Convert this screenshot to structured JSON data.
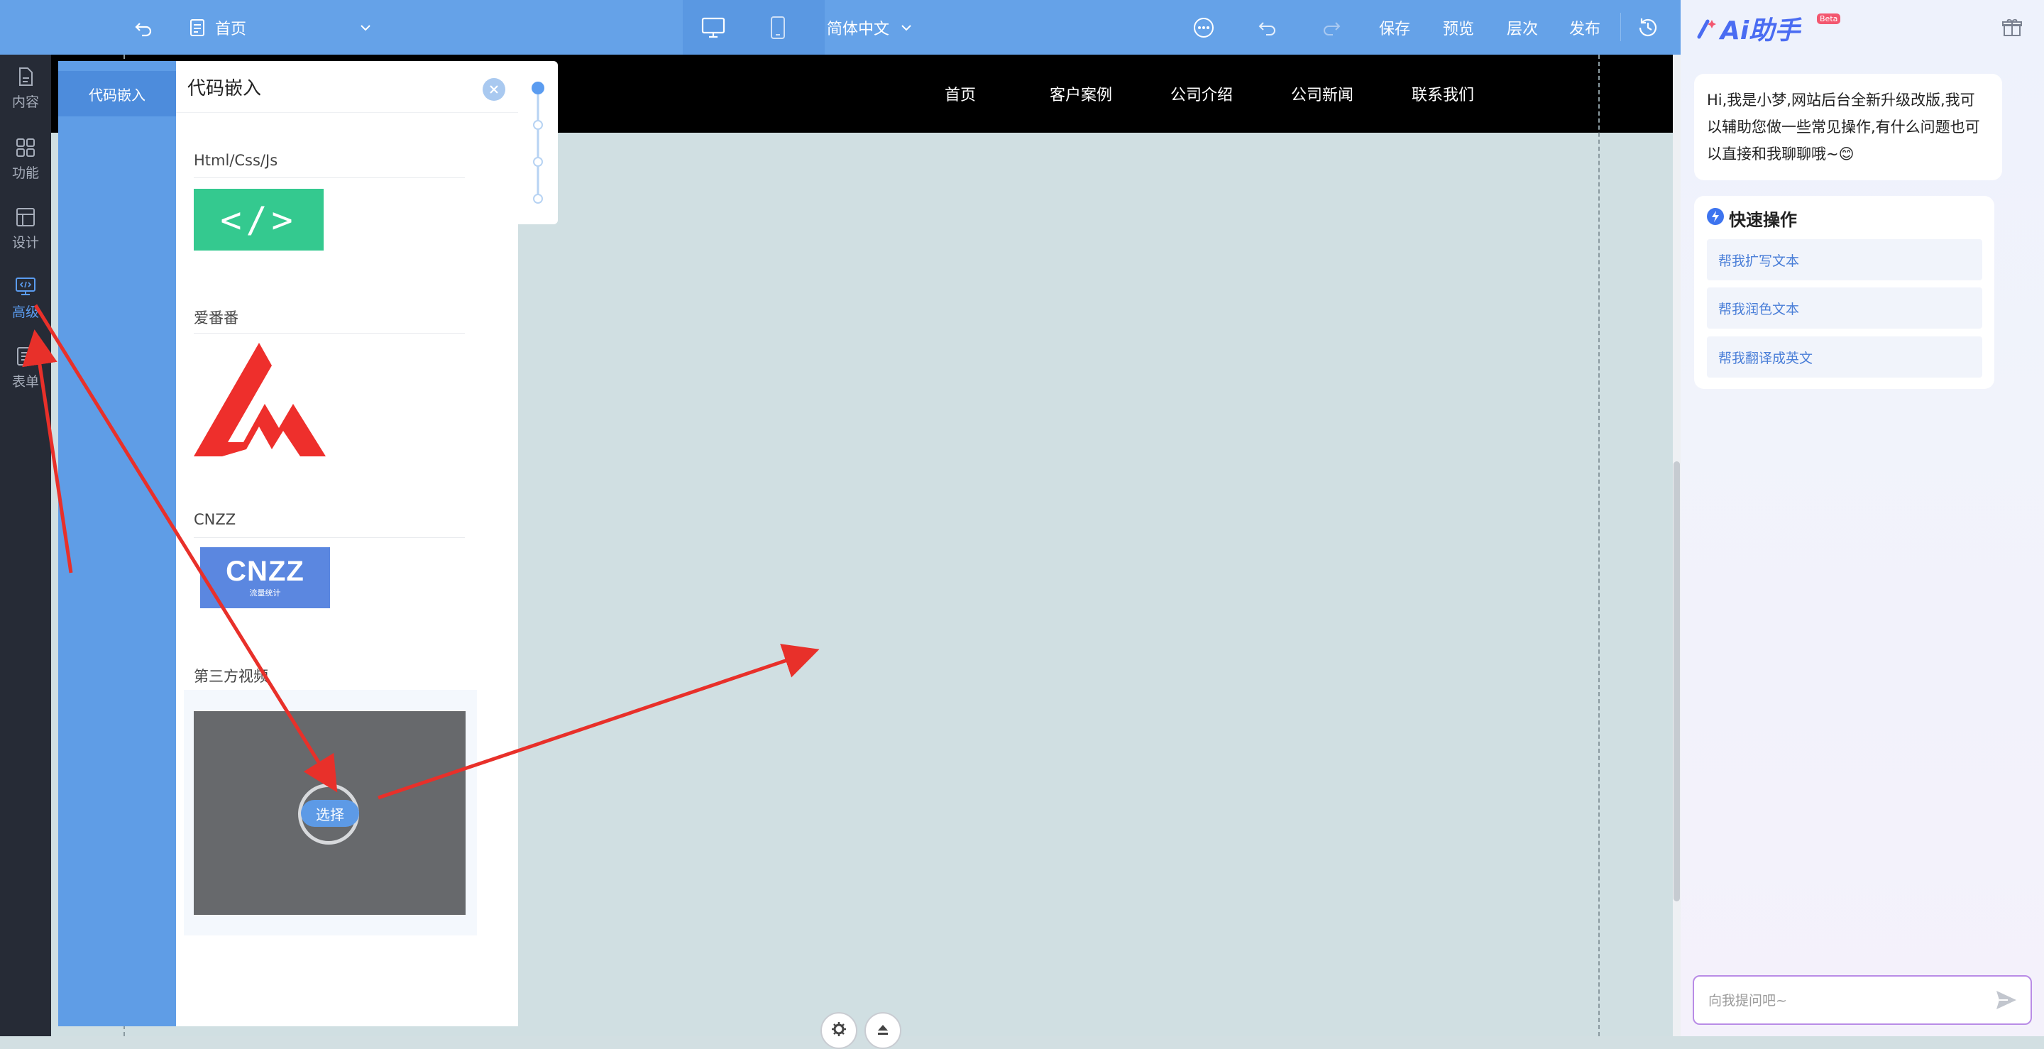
{
  "toolbar": {
    "page_name": "首页",
    "language": "简体中文",
    "actions": [
      "保存",
      "预览",
      "层次",
      "发布"
    ]
  },
  "rail": {
    "items": [
      {
        "label": "内容",
        "icon": "document-icon"
      },
      {
        "label": "功能",
        "icon": "grid-icon"
      },
      {
        "label": "设计",
        "icon": "layout-icon"
      },
      {
        "label": "高级",
        "icon": "code-monitor-icon",
        "active": true
      },
      {
        "label": "表单",
        "icon": "list-form-icon"
      }
    ]
  },
  "site_nav": {
    "links": [
      "首页",
      "客户案例",
      "公司介绍",
      "公司新闻",
      "联系我们"
    ]
  },
  "panel": {
    "tab": "代码嵌入",
    "title": "代码嵌入",
    "sections": [
      {
        "title": "Html/Css/Js",
        "thumb_text": "</>"
      },
      {
        "title": "爱番番"
      },
      {
        "title": "CNZZ",
        "thumb_text": "CNZZ",
        "thumb_sub": "流量统计"
      },
      {
        "title": "第三方视频",
        "button": "选择"
      }
    ]
  },
  "ai": {
    "title": "Ai助手",
    "badge": "Beta",
    "greeting": "Hi,我是小梦,网站后台全新升级改版,我可以辅助您做一些常见操作,有什么问题也可以直接和我聊聊哦~😊",
    "quick_title": "快速操作",
    "quick_actions": [
      "帮我扩写文本",
      "帮我润色文本",
      "帮我翻译成英文"
    ],
    "input_placeholder": "向我提问吧~"
  },
  "colors": {
    "toolbar": "#65a2e8",
    "rail": "#262b36",
    "accent": "#5b9cf0",
    "annotation_arrow": "#e8302a"
  }
}
